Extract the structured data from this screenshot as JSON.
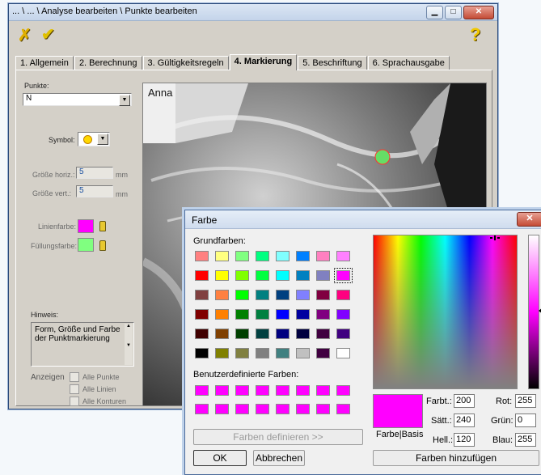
{
  "window": {
    "title": "... \\ ... \\ Analyse bearbeiten \\ Punkte bearbeiten",
    "buttons": [
      "minimize",
      "maximize",
      "close"
    ]
  },
  "toolbar": {
    "cancel_icon": "x-icon",
    "ok_icon": "check-icon",
    "help_icon": "help-icon"
  },
  "tabs": [
    {
      "label": "1. Allgemein"
    },
    {
      "label": "2. Berechnung"
    },
    {
      "label": "3. Gültigkeitsregeln"
    },
    {
      "label": "4. Markierung",
      "active": true
    },
    {
      "label": "5. Beschriftung"
    },
    {
      "label": "6. Sprachausgabe"
    }
  ],
  "form": {
    "punkte_label": "Punkte:",
    "punkte_value": "N",
    "symbol_label": "Symbol:",
    "groesse_horiz_label": "Größe horiz.:",
    "groesse_horiz_value": "5",
    "groesse_vert_label": "Größe vert.:",
    "groesse_vert_value": "5",
    "unit": "mm",
    "linienfarbe_label": "Linienfarbe:",
    "linienfarbe_color": "#ff00ff",
    "fuellungsfarbe_label": "Füllungsfarbe:",
    "fuellungsfarbe_color": "#80ff80",
    "hinweis_label": "Hinweis:",
    "hinweis_text": "Form, Größe und Farbe der Punktmarkierung",
    "anzeigen_label": "Anzeigen",
    "checkboxes": [
      "Alle Punkte",
      "Alle Linien",
      "Alle Konturen"
    ]
  },
  "xray": {
    "name": "Anna",
    "marker_color": "#66dd66",
    "marker_border": "#ff3030"
  },
  "dialog": {
    "title": "Farbe",
    "grundfarben_label": "Grundfarben:",
    "grundfarben": [
      [
        "#ff8080",
        "#ffff80",
        "#80ff80",
        "#00ff80",
        "#80ffff",
        "#0080ff",
        "#ff80c0",
        "#ff80ff"
      ],
      [
        "#ff0000",
        "#ffff00",
        "#80ff00",
        "#00ff40",
        "#00ffff",
        "#0080c0",
        "#8080c0",
        "#ff00ff"
      ],
      [
        "#804040",
        "#ff8040",
        "#00ff00",
        "#008080",
        "#004080",
        "#8080ff",
        "#800040",
        "#ff0080"
      ],
      [
        "#800000",
        "#ff8000",
        "#008000",
        "#008040",
        "#0000ff",
        "#0000a0",
        "#800080",
        "#8000ff"
      ],
      [
        "#400000",
        "#804000",
        "#004000",
        "#004040",
        "#000080",
        "#000040",
        "#400040",
        "#400080"
      ],
      [
        "#000000",
        "#808000",
        "#808040",
        "#808080",
        "#408080",
        "#c0c0c0",
        "#400040",
        "#ffffff"
      ]
    ],
    "selected_cell": [
      1,
      7
    ],
    "benutzer_label": "Benutzerdefinierte Farben:",
    "benutzer_colors": [
      "#ff00ff",
      "#ff00ff",
      "#ff00ff",
      "#ff00ff",
      "#ff00ff",
      "#ff00ff",
      "#ff00ff",
      "#ff00ff",
      "#ff00ff",
      "#ff00ff",
      "#ff00ff",
      "#ff00ff",
      "#ff00ff",
      "#ff00ff",
      "#ff00ff",
      "#ff00ff"
    ],
    "define_button": "Farben definieren >>",
    "ok_button": "OK",
    "cancel_button": "Abbrechen",
    "add_button": "Farben hinzufügen",
    "preview_label": "Farbe|Basis",
    "preview_color": "#ff00ff",
    "farbt_label": "Farbt.:",
    "farbt_value": "200",
    "saett_label": "Sätt.:",
    "saett_value": "240",
    "hell_label": "Hell.:",
    "hell_value": "120",
    "rot_label": "Rot:",
    "rot_value": "255",
    "gruen_label": "Grün:",
    "gruen_value": "0",
    "blau_label": "Blau:",
    "blau_value": "255"
  }
}
